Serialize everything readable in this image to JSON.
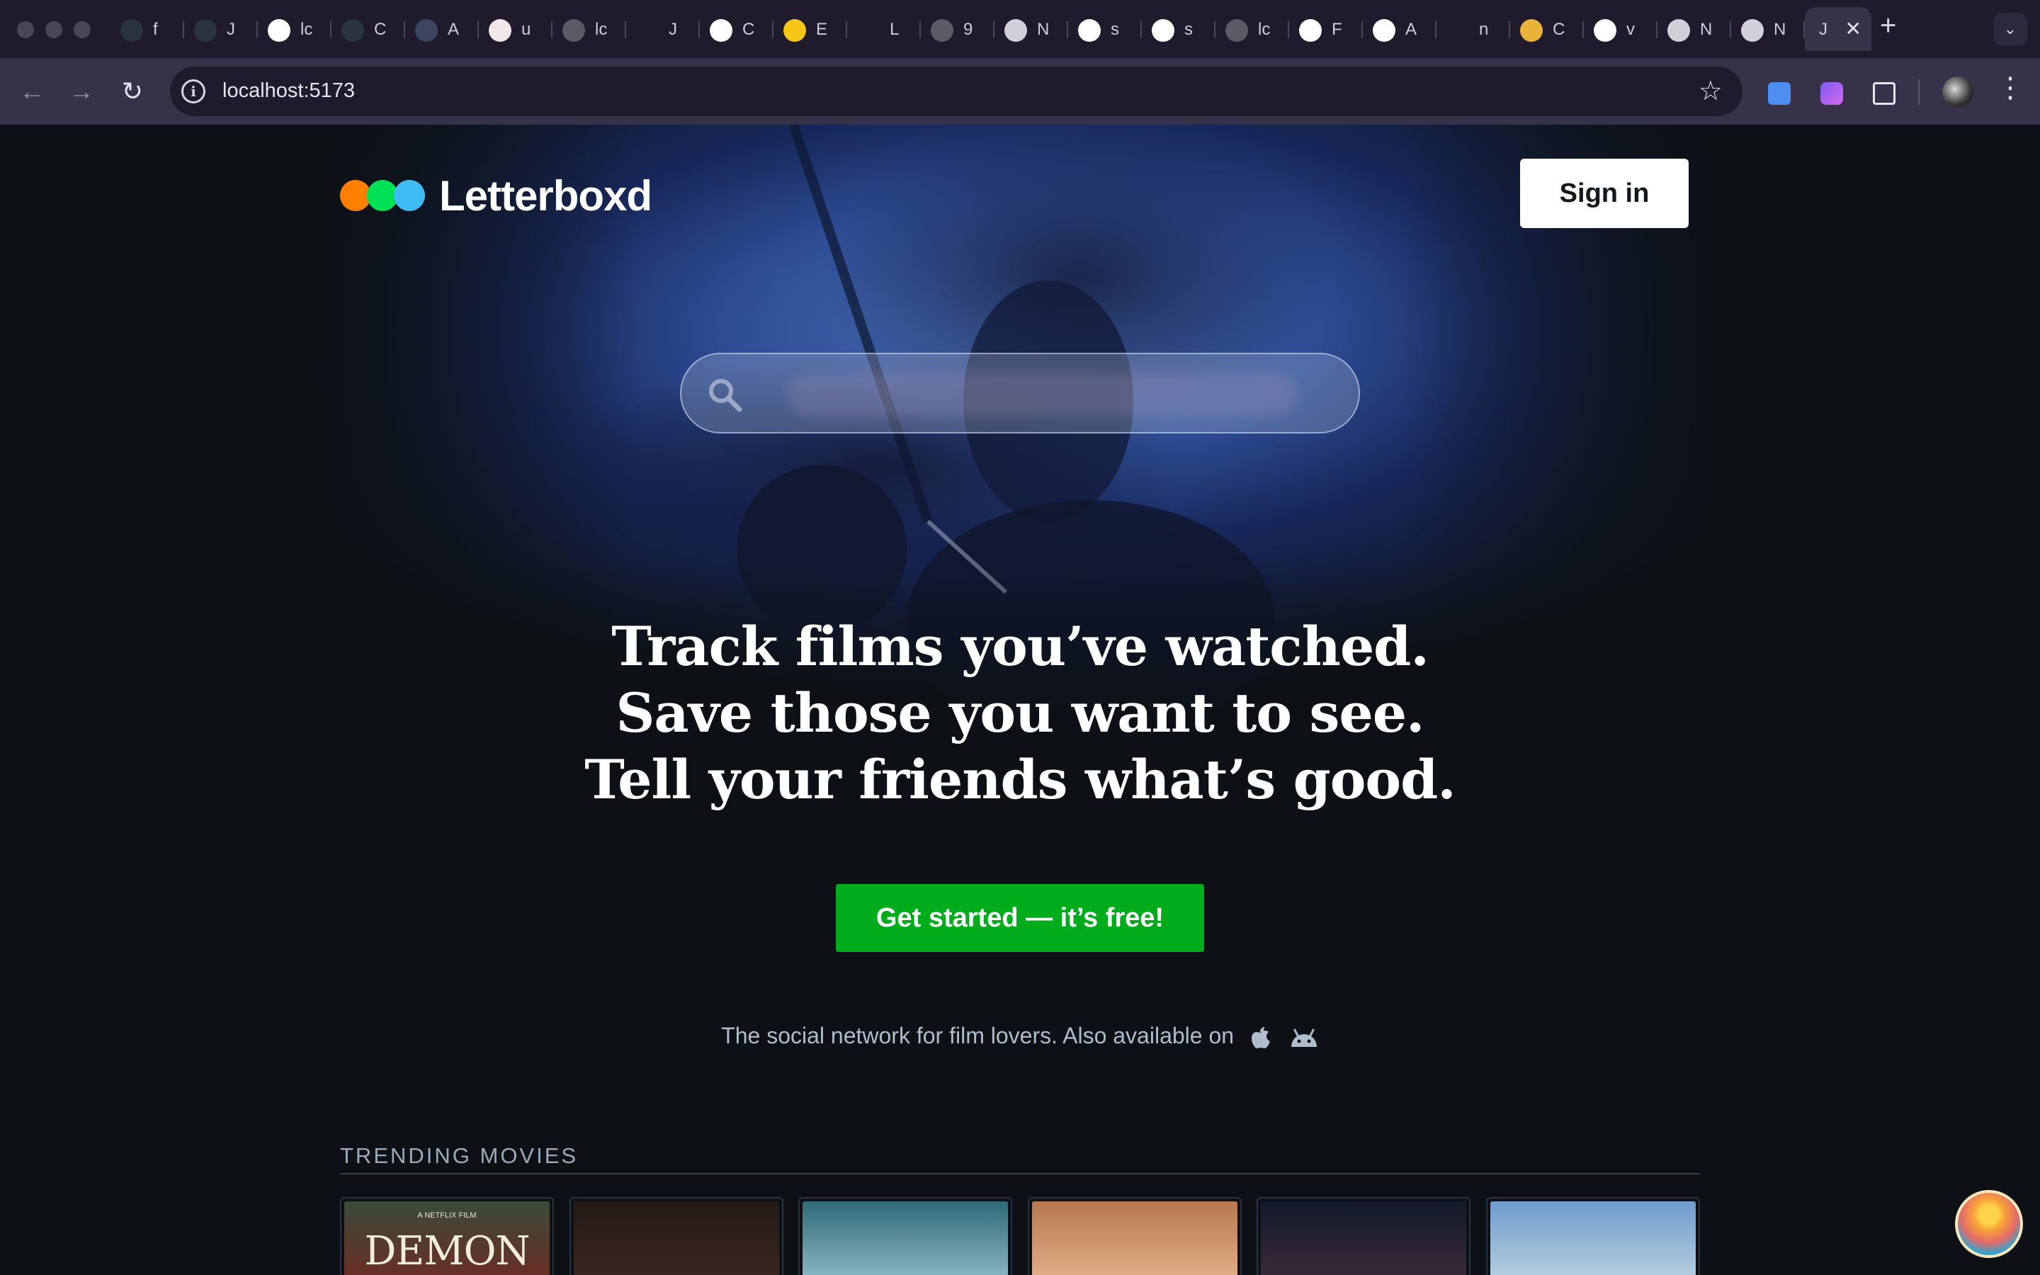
{
  "browser": {
    "tabs": [
      {
        "title": "f",
        "icon": "letterboxd-dots-icon"
      },
      {
        "title": "J",
        "icon": "letterboxd-dots-icon"
      },
      {
        "title": "lc",
        "icon": "github-icon"
      },
      {
        "title": "C",
        "icon": "letterboxd-dots-icon"
      },
      {
        "title": "A",
        "icon": "character-avatar-icon"
      },
      {
        "title": "u",
        "icon": "avatar-icon"
      },
      {
        "title": "lc",
        "icon": "globe-icon"
      },
      {
        "title": "J",
        "icon": "scissors-icon"
      },
      {
        "title": "C",
        "icon": "openai-icon"
      },
      {
        "title": "E",
        "icon": "imdb-icon"
      },
      {
        "title": "L",
        "icon": "dash-icon"
      },
      {
        "title": "9",
        "icon": "globe-icon"
      },
      {
        "title": "N",
        "icon": "chromium-icon"
      },
      {
        "title": "s",
        "icon": "google-icon"
      },
      {
        "title": "s",
        "icon": "google-icon"
      },
      {
        "title": "lc",
        "icon": "globe-icon"
      },
      {
        "title": "F",
        "icon": "gmail-icon"
      },
      {
        "title": "A",
        "icon": "openai-icon"
      },
      {
        "title": "n",
        "icon": "stackoverflow-icon"
      },
      {
        "title": "C",
        "icon": "colorful-icon"
      },
      {
        "title": "v",
        "icon": "google-icon"
      },
      {
        "title": "N",
        "icon": "chromium-icon"
      },
      {
        "title": "N",
        "icon": "chromium-icon"
      }
    ],
    "active_tab": {
      "title": "J",
      "close": "✕"
    },
    "new_tab": "+",
    "url": "localhost:5173",
    "nav": {
      "back": "←",
      "forward": "→",
      "reload": "↻"
    },
    "kebab": "⋮"
  },
  "site": {
    "logo_text": "Letterboxd",
    "logo_colors": [
      "#ff8000",
      "#00e054",
      "#40bcf4"
    ],
    "signin_label": "Sign in",
    "search_placeholder": "",
    "tagline": [
      "Track films you’ve watched.",
      "Save those you want to see.",
      "Tell your friends what’s good."
    ],
    "cta_label": "Get started — it’s free!",
    "social_text": "The social network for film lovers. Also available on",
    "trending_header": "TRENDING MOVIES",
    "posters": [
      {
        "small": "A NETFLIX FILM",
        "title": "DEMON CITY",
        "colors": [
          "#3a4a38",
          "#6b2d25"
        ]
      },
      {
        "small": "",
        "title": "",
        "colors": [
          "#241a18",
          "#3b2620"
        ]
      },
      {
        "small": "",
        "title": "",
        "colors": [
          "#2e6a78",
          "#8fb8c6"
        ]
      },
      {
        "small": "",
        "title": "",
        "colors": [
          "#b5784e",
          "#e4b08a"
        ]
      },
      {
        "small": "",
        "title": "",
        "colors": [
          "#141a2a",
          "#3a2a3a"
        ]
      },
      {
        "small": "",
        "title": "",
        "colors": [
          "#6f9ccc",
          "#b8cfe0"
        ]
      }
    ]
  },
  "colors": {
    "accent_green": "#00ac1c",
    "page_bg": "#0d1116",
    "chrome_bg": "#1f1b2c",
    "toolbar_bg": "#37324a"
  }
}
